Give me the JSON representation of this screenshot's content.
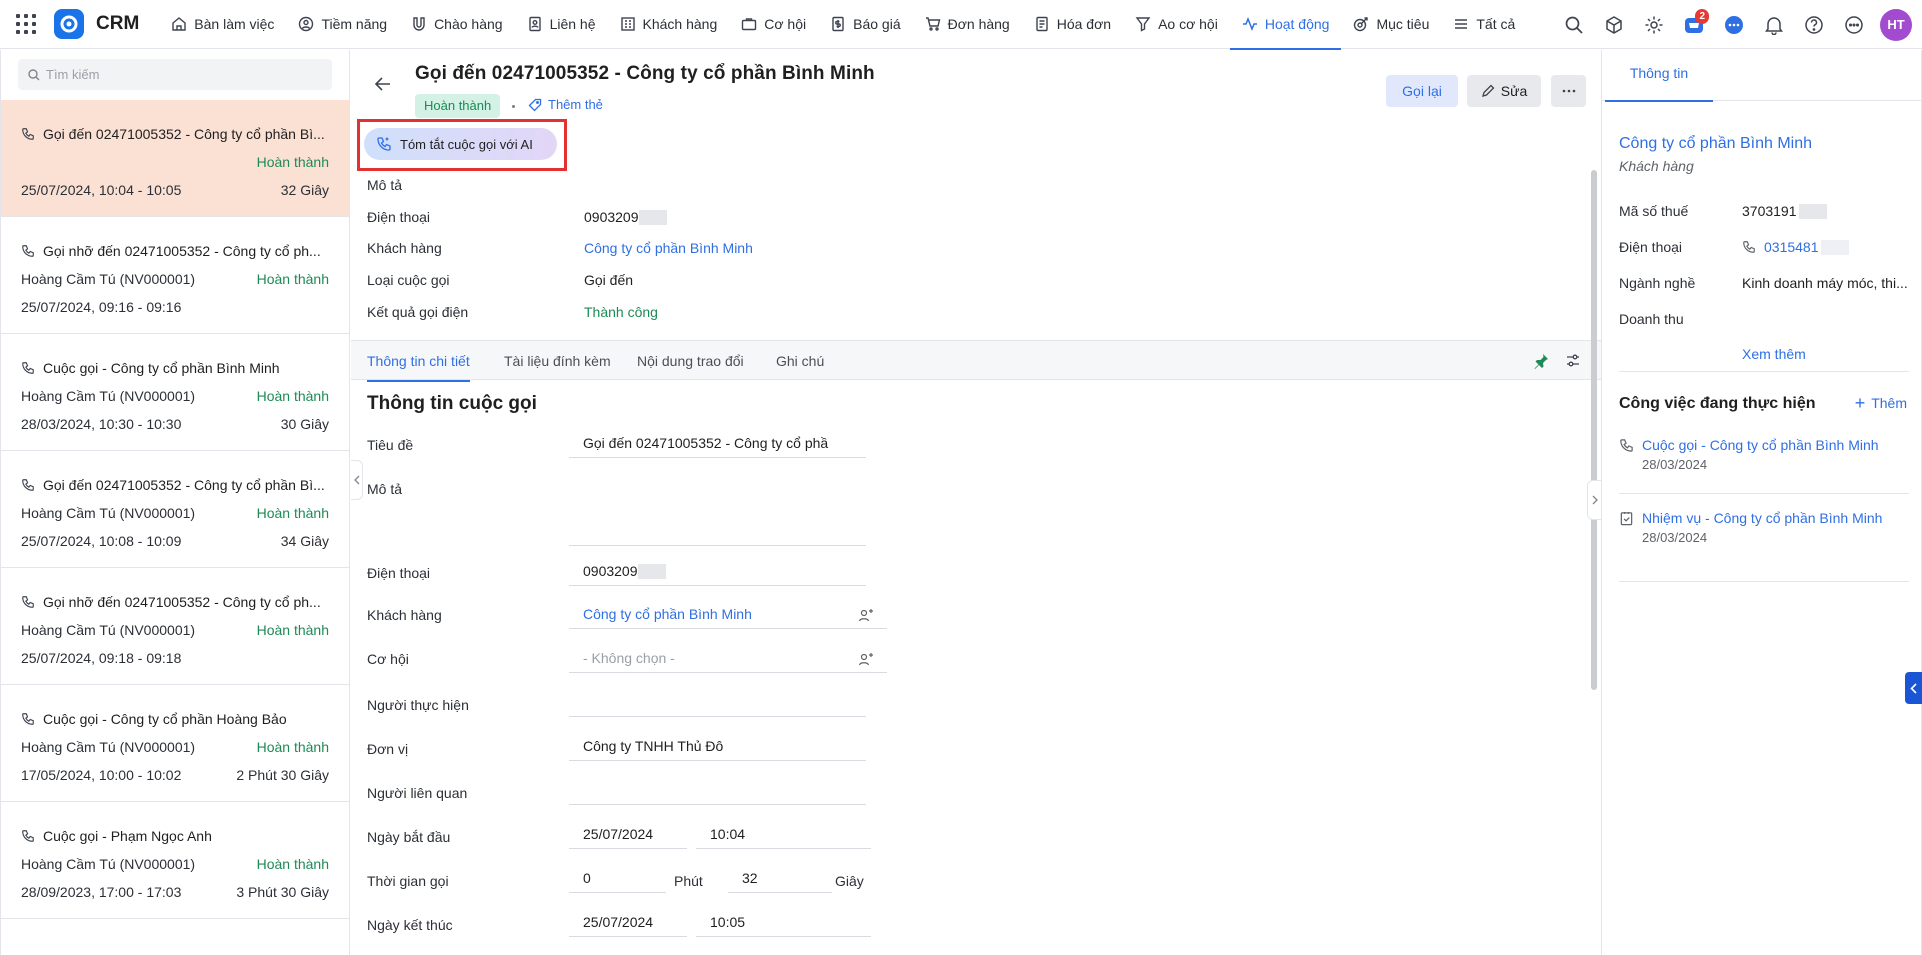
{
  "app": {
    "name": "CRM",
    "brand_color": "#1a73e8",
    "accent": "#2f6fe4"
  },
  "nav": [
    {
      "label": "Bàn làm việc",
      "icon": "house-icon"
    },
    {
      "label": "Tiềm năng",
      "icon": "target-person-icon"
    },
    {
      "label": "Chào hàng",
      "icon": "magnet-icon"
    },
    {
      "label": "Liên hệ",
      "icon": "contact-icon"
    },
    {
      "label": "Khách hàng",
      "icon": "building-icon"
    },
    {
      "label": "Cơ hội",
      "icon": "briefcase-icon"
    },
    {
      "label": "Báo giá",
      "icon": "dollar-doc-icon"
    },
    {
      "label": "Đơn hàng",
      "icon": "cart-icon"
    },
    {
      "label": "Hóa đơn",
      "icon": "invoice-icon"
    },
    {
      "label": "Ao cơ hội",
      "icon": "funnel-icon"
    },
    {
      "label": "Hoạt động",
      "icon": "activity-icon",
      "active": true
    },
    {
      "label": "Mục tiêu",
      "icon": "goal-icon"
    },
    {
      "label": "Tất cả",
      "icon": "menu-icon"
    }
  ],
  "toolbar": {
    "cart_badge": "2",
    "avatar": "HT"
  },
  "list": {
    "search_placeholder": "Tìm kiếm",
    "items": [
      {
        "title": "Gọi đến 02471005352 - Công ty cổ phần Bì...",
        "owner": "",
        "status": "Hoàn thành",
        "date": "25/07/2024, 10:04 - 10:05",
        "duration": "32 Giây",
        "selected": true
      },
      {
        "title": "Gọi nhỡ đến 02471005352 - Công ty cổ ph...",
        "owner": "Hoàng Cầm Tú (NV000001)",
        "status": "Hoàn thành",
        "date": "25/07/2024, 09:16 - 09:16",
        "duration": ""
      },
      {
        "title": "Cuộc gọi - Công ty cổ phần Bình Minh",
        "owner": "Hoàng Cầm Tú (NV000001)",
        "status": "Hoàn thành",
        "date": "28/03/2024, 10:30 - 10:30",
        "duration": "30 Giây"
      },
      {
        "title": "Gọi đến 02471005352 - Công ty cổ phần Bì...",
        "owner": "Hoàng Cầm Tú (NV000001)",
        "status": "Hoàn thành",
        "date": "25/07/2024, 10:08 - 10:09",
        "duration": "34 Giây"
      },
      {
        "title": "Gọi nhỡ đến 02471005352 - Công ty cổ ph...",
        "owner": "Hoàng Cầm Tú (NV000001)",
        "status": "Hoàn thành",
        "date": "25/07/2024, 09:18 - 09:18",
        "duration": ""
      },
      {
        "title": "Cuộc gọi - Công ty cổ phần Hoàng Bảo",
        "owner": "Hoàng Cầm Tú (NV000001)",
        "status": "Hoàn thành",
        "date": "17/05/2024, 10:00 - 10:02",
        "duration": "2 Phút 30 Giây"
      },
      {
        "title": "Cuộc gọi - Phạm Ngọc Anh",
        "owner": "Hoàng Cầm Tú (NV000001)",
        "status": "Hoàn thành",
        "date": "28/09/2023, 17:00 - 17:03",
        "duration": "3 Phút 30 Giây"
      }
    ]
  },
  "detail": {
    "title": "Gọi đến 02471005352 - Công ty cổ phần Bình Minh",
    "status": "Hoàn thành",
    "add_tag": "Thêm thẻ",
    "callback": "Gọi lại",
    "edit": "Sửa",
    "ai_summary": "Tóm tắt cuộc gọi với AI",
    "summary": {
      "desc_label": "Mô tả",
      "phone_label": "Điện thoại",
      "phone": "0903209",
      "customer_label": "Khách hàng",
      "customer": "Công ty cổ phần Bình Minh",
      "type_label": "Loại cuộc gọi",
      "type": "Gọi đến",
      "result_label": "Kết quả gọi điện",
      "result": "Thành công"
    },
    "tabs": [
      "Thông tin chi tiết",
      "Tài liệu đính kèm",
      "Nội dung trao đổi",
      "Ghi chú"
    ],
    "section_title": "Thông tin cuộc gọi",
    "form": {
      "subject_label": "Tiêu đề",
      "subject": "Gọi đến 02471005352 - Công ty cổ phầ",
      "desc_label": "Mô tả",
      "desc": "",
      "phone_label": "Điện thoại",
      "phone": "0903209",
      "customer_label": "Khách hàng",
      "customer": "Công ty cổ phần Bình Minh",
      "opportunity_label": "Cơ hội",
      "opportunity": "- Không chọn -",
      "assignee_label": "Người thực hiện",
      "assignee": "",
      "unit_label": "Đơn vị",
      "unit": "Công ty TNHH Thủ Đô",
      "related_label": "Người liên quan",
      "related": "",
      "start_label": "Ngày bắt đầu",
      "start_date": "25/07/2024",
      "start_time": "10:04",
      "duration_label": "Thời gian gọi",
      "minutes": "0",
      "minutes_unit": "Phút",
      "seconds": "32",
      "seconds_unit": "Giây",
      "end_label": "Ngày kết thúc",
      "end_date": "25/07/2024",
      "end_time": "10:05"
    }
  },
  "side": {
    "tab": "Thông tin",
    "company": "Công ty cổ phần Bình Minh",
    "company_type": "Khách hàng",
    "tax_label": "Mã số thuế",
    "tax": "3703191",
    "phone_label": "Điện thoại",
    "phone": "0315481",
    "industry_label": "Ngành nghề",
    "industry": "Kinh doanh máy móc, thi...",
    "revenue_label": "Doanh thu",
    "revenue": "",
    "more": "Xem thêm",
    "tasks_title": "Công việc đang thực hiện",
    "tasks_add": "Thêm",
    "tasks": [
      {
        "title": "Cuộc gọi - Công ty cổ phần Bình Minh",
        "date": "28/03/2024",
        "icon": "phone-icon"
      },
      {
        "title": "Nhiệm vụ - Công ty cổ phần Bình Minh",
        "date": "28/03/2024",
        "icon": "task-icon"
      }
    ]
  }
}
